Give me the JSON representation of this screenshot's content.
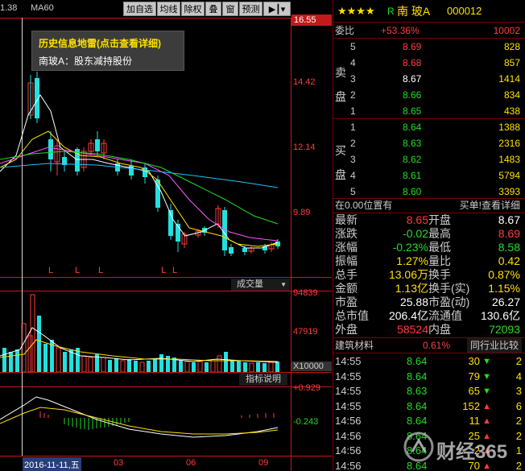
{
  "topbar": {
    "price_partial": "1.38",
    "ma_label": "MA60",
    "buttons": [
      "加自选",
      "均线",
      "除权",
      "叠",
      "窗",
      "预测"
    ]
  },
  "tooltip": {
    "title": "历史信息地雷(点击查看详细)",
    "body": "南玻A：股东减持股份"
  },
  "kline_y": {
    "top": "16.55",
    "v1": "14.42",
    "v2": "12.14",
    "v3": "9.89"
  },
  "vol_y": {
    "v1": "94839",
    "v2": "47919",
    "unit": "X10000"
  },
  "macd_y": {
    "v1": "+0.929",
    "v2": "-0.243"
  },
  "vol_menu": "成交量",
  "indicator_btn": "指标说明",
  "date_axis": {
    "start": "2016-11-11,五",
    "m1": "03",
    "m2": "06",
    "m3": "09"
  },
  "stock": {
    "stars": "★★★★",
    "r": "R",
    "name": "南 玻A",
    "code": "000012"
  },
  "weibi": {
    "label": "委比",
    "pct": "+53.36%",
    "val": "10002"
  },
  "sell_label": [
    "卖",
    "盘"
  ],
  "buy_label": [
    "买",
    "盘"
  ],
  "sell": [
    {
      "lvl": "5",
      "price": "8.69",
      "vol": "828"
    },
    {
      "lvl": "4",
      "price": "8.68",
      "vol": "857"
    },
    {
      "lvl": "3",
      "price": "8.67",
      "vol": "1414"
    },
    {
      "lvl": "2",
      "price": "8.66",
      "vol": "834"
    },
    {
      "lvl": "1",
      "price": "8.65",
      "vol": "438"
    }
  ],
  "buy": [
    {
      "lvl": "1",
      "price": "8.64",
      "vol": "1388"
    },
    {
      "lvl": "2",
      "price": "8.63",
      "vol": "2316"
    },
    {
      "lvl": "3",
      "price": "8.62",
      "vol": "1483"
    },
    {
      "lvl": "4",
      "price": "8.61",
      "vol": "5794"
    },
    {
      "lvl": "5",
      "price": "8.60",
      "vol": "3393"
    }
  ],
  "position": {
    "left": "在0.00位置有",
    "right": "买单!查看详细"
  },
  "quote": [
    {
      "l": "最新",
      "lv": "8.65",
      "r": "开盘",
      "rv": "8.67"
    },
    {
      "l": "涨跌",
      "lv": "-0.02",
      "r": "最高",
      "rv": "8.69"
    },
    {
      "l": "涨幅",
      "lv": "-0.23%",
      "r": "最低",
      "rv": "8.58"
    },
    {
      "l": "振幅",
      "lv": "1.27%",
      "r": "量比",
      "rv": "0.42"
    },
    {
      "l": "总手",
      "lv": "13.06万",
      "r": "换手",
      "rv": "0.87%"
    },
    {
      "l": "金额",
      "lv": "1.13亿",
      "r": "换手(实)",
      "rv": "1.15%"
    },
    {
      "l": "市盈",
      "lv": "25.88",
      "r": "市盈(动)",
      "rv": "26.27"
    },
    {
      "l": "总市值",
      "lv": "206.4亿",
      "r": "流通值",
      "rv": "130.6亿"
    },
    {
      "l": "外盘",
      "lv": "58524",
      "r": "内盘",
      "rv": "72093"
    }
  ],
  "industry": {
    "name": "建筑材料",
    "pct": "0.61%",
    "btn": "同行业比较"
  },
  "ticks": [
    {
      "t": "14:55",
      "p": "8.64",
      "v": "30",
      "d": "down",
      "n": "2"
    },
    {
      "t": "14:55",
      "p": "8.64",
      "v": "79",
      "d": "down",
      "n": "4"
    },
    {
      "t": "14:55",
      "p": "8.63",
      "v": "65",
      "d": "down",
      "n": "3"
    },
    {
      "t": "14:55",
      "p": "8.64",
      "v": "152",
      "d": "up",
      "n": "6"
    },
    {
      "t": "14:56",
      "p": "8.64",
      "v": "11",
      "d": "up",
      "n": "2"
    },
    {
      "t": "14:56",
      "p": "8.64",
      "v": "25",
      "d": "up",
      "n": "2"
    },
    {
      "t": "14:56",
      "p": "8.64",
      "v": "2",
      "d": "up",
      "n": "1"
    },
    {
      "t": "14:56",
      "p": "8.64",
      "v": "70",
      "d": "up",
      "n": "2"
    }
  ],
  "watermark": "财经365"
}
